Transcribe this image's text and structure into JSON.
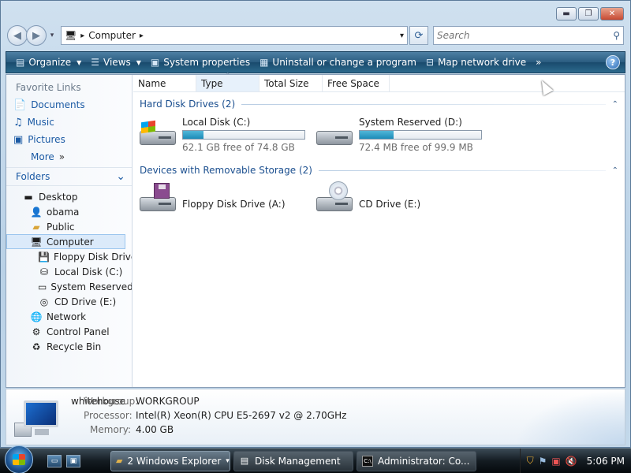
{
  "window": {
    "controls": {
      "minimize": "▬",
      "maximize": "❐",
      "close": "✕"
    }
  },
  "nav": {
    "back": "◀",
    "forward": "▶",
    "dropdown": "▾"
  },
  "address": {
    "path": "Computer",
    "sep": "▸",
    "dropdown": "▾",
    "refresh": "⟳"
  },
  "search": {
    "placeholder": "Search",
    "icon": "⚲"
  },
  "toolbar": {
    "organize": "Organize",
    "views": "Views",
    "system_properties": "System properties",
    "uninstall": "Uninstall or change a program",
    "map_drive": "Map network drive",
    "more": "»",
    "help": "?"
  },
  "sidebar": {
    "favorites_header": "Favorite Links",
    "favorites": [
      "Documents",
      "Music",
      "Pictures"
    ],
    "more": "More",
    "more_arrow": "»",
    "folders_header": "Folders",
    "folders_chevron": "⌄",
    "tree": [
      {
        "label": "Desktop",
        "icon": "desktop-icon"
      },
      {
        "label": "obama",
        "icon": "user-folder-icon"
      },
      {
        "label": "Public",
        "icon": "folder-icon"
      },
      {
        "label": "Computer",
        "icon": "computer-icon"
      },
      {
        "label": "Floppy Disk Drive",
        "icon": "floppy-drive-icon"
      },
      {
        "label": "Local Disk (C:)",
        "icon": "local-disk-icon"
      },
      {
        "label": "System Reserved (",
        "icon": "disk-icon"
      },
      {
        "label": "CD Drive (E:)",
        "icon": "cd-drive-icon"
      },
      {
        "label": "Network",
        "icon": "network-icon"
      },
      {
        "label": "Control Panel",
        "icon": "control-panel-icon"
      },
      {
        "label": "Recycle Bin",
        "icon": "recycle-bin-icon"
      }
    ]
  },
  "columns": [
    "Name",
    "Type",
    "Total Size",
    "Free Space"
  ],
  "groups": {
    "hard": {
      "title": "Hard Disk Drives (2)",
      "chevron": "⌃"
    },
    "removable": {
      "title": "Devices with Removable Storage (2)",
      "chevron": "⌃"
    }
  },
  "drives": {
    "c": {
      "name": "Local Disk (C:)",
      "free": "62.1 GB free of 74.8 GB",
      "used_fraction": 0.17
    },
    "d": {
      "name": "System Reserved (D:)",
      "free": "72.4 MB free of 99.9 MB",
      "used_fraction": 0.28
    },
    "a": {
      "name": "Floppy Disk Drive (A:)"
    },
    "e": {
      "name": "CD Drive (E:)"
    }
  },
  "details": {
    "name": "whitehouse",
    "workgroup_label": "Workgroup:",
    "workgroup": "WORKGROUP",
    "processor_label": "Processor:",
    "processor": "Intel(R) Xeon(R) CPU E5-2697 v2 @ 2.70GHz",
    "memory_label": "Memory:",
    "memory": "4.00 GB"
  },
  "taskbar": {
    "tasks": [
      {
        "label": "2 Windows Explorer"
      },
      {
        "label": "Disk Management"
      },
      {
        "label": "Administrator: Co..."
      }
    ],
    "task_arrow": "▾",
    "clock": "5:06 PM"
  }
}
